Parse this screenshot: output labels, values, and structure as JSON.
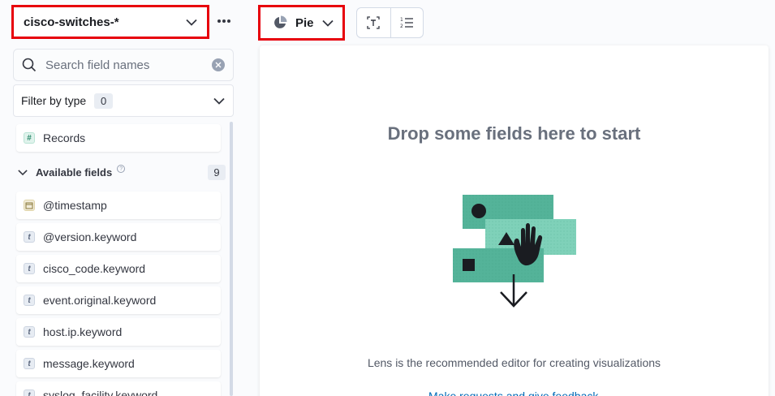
{
  "index_pattern": {
    "label": "cisco-switches-*"
  },
  "search": {
    "placeholder": "Search field names",
    "value": ""
  },
  "filter_by_type": {
    "label": "Filter by type",
    "count": "0"
  },
  "records_field": {
    "label": "Records",
    "type_icon": "number-token-icon"
  },
  "available_fields": {
    "label": "Available fields",
    "count": "9",
    "items": [
      {
        "label": "@timestamp",
        "type_icon": "date-token-icon"
      },
      {
        "label": "@version.keyword",
        "type_icon": "string-token-icon"
      },
      {
        "label": "cisco_code.keyword",
        "type_icon": "string-token-icon"
      },
      {
        "label": "event.original.keyword",
        "type_icon": "string-token-icon"
      },
      {
        "label": "host.ip.keyword",
        "type_icon": "string-token-icon"
      },
      {
        "label": "message.keyword",
        "type_icon": "string-token-icon"
      },
      {
        "label": "syslog_facility.keyword",
        "type_icon": "string-token-icon"
      }
    ]
  },
  "toolbar": {
    "chart_type_label": "Pie",
    "chart_type_icon": "pie-chart-icon",
    "icons": [
      "text-cursor-icon",
      "list-order-icon"
    ]
  },
  "workspace": {
    "title": "Drop some fields here to start",
    "description": "Lens is the recommended editor for creating visualizations",
    "link": "Make requests and give feedback"
  },
  "colors": {
    "highlight_border": "#e7000b",
    "accent_green": "#54b399",
    "link_blue": "#006bb8",
    "text_primary": "#343741",
    "text_muted": "#69707d"
  }
}
